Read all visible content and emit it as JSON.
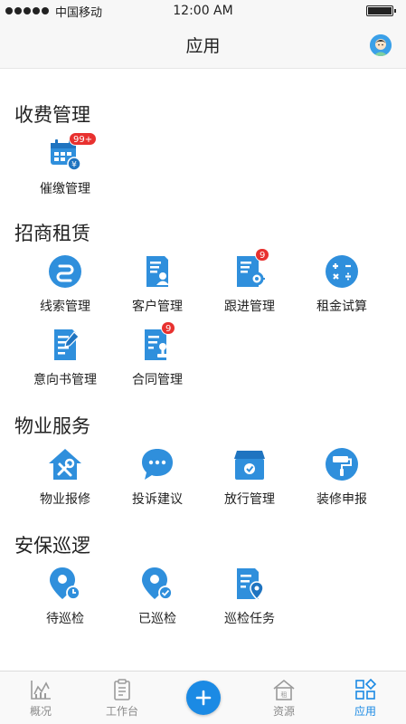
{
  "status_bar": {
    "carrier": "中国移动",
    "time": "12:00 AM",
    "battery_level": 1.0
  },
  "nav": {
    "title": "应用",
    "avatar_icon": "user-avatar-icon"
  },
  "colors": {
    "accent": "#1b8ae4",
    "icon_blue": "#2f8fdc",
    "badge_red": "#e8312f"
  },
  "sections": [
    {
      "title": "收费管理",
      "items": [
        {
          "label": "催缴管理",
          "icon": "calendar-payment-icon",
          "badge": "99+"
        }
      ]
    },
    {
      "title": "招商租赁",
      "items": [
        {
          "label": "线索管理",
          "icon": "clue-link-icon",
          "badge": ""
        },
        {
          "label": "客户管理",
          "icon": "customer-doc-icon",
          "badge": ""
        },
        {
          "label": "跟进管理",
          "icon": "follow-up-doc-icon",
          "badge": "9"
        },
        {
          "label": "租金试算",
          "icon": "calculator-icon",
          "badge": ""
        },
        {
          "label": "意向书管理",
          "icon": "intent-doc-edit-icon",
          "badge": ""
        },
        {
          "label": "合同管理",
          "icon": "contract-stamp-icon",
          "badge": "9"
        }
      ]
    },
    {
      "title": "物业服务",
      "items": [
        {
          "label": "物业报修",
          "icon": "house-repair-icon",
          "badge": ""
        },
        {
          "label": "投诉建议",
          "icon": "chat-bubble-icon",
          "badge": ""
        },
        {
          "label": "放行管理",
          "icon": "box-check-icon",
          "badge": ""
        },
        {
          "label": "装修申报",
          "icon": "paint-roller-icon",
          "badge": ""
        }
      ]
    },
    {
      "title": "安保巡逻",
      "items": [
        {
          "label": "待巡检",
          "icon": "pin-clock-icon",
          "badge": ""
        },
        {
          "label": "已巡检",
          "icon": "pin-check-icon",
          "badge": ""
        },
        {
          "label": "巡检任务",
          "icon": "doc-pin-icon",
          "badge": ""
        }
      ]
    }
  ],
  "tab_bar": {
    "items": [
      {
        "label": "概况",
        "icon": "chart-icon",
        "active": false
      },
      {
        "label": "工作台",
        "icon": "clipboard-icon",
        "active": false
      },
      {
        "label": "",
        "icon": "plus-icon",
        "active": false
      },
      {
        "label": "资源",
        "icon": "building-icon",
        "active": false
      },
      {
        "label": "应用",
        "icon": "apps-grid-icon",
        "active": true
      }
    ]
  }
}
